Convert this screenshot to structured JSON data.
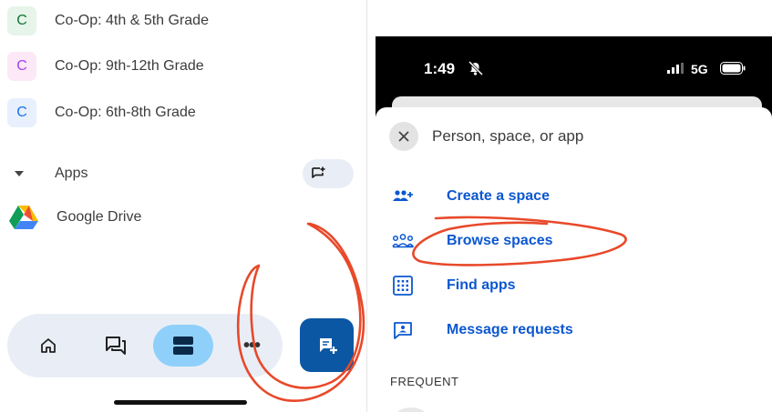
{
  "left_panel": {
    "spaces": [
      {
        "initial": "C",
        "label": "Co-Op: 4th & 5th Grade",
        "bg": "#e6f4ea",
        "fg": "#137333"
      },
      {
        "initial": "C",
        "label": "Co-Op: 9th-12th Grade",
        "bg": "#fce8f6",
        "fg": "#a142f4"
      },
      {
        "initial": "C",
        "label": "Co-Op: 6th-8th Grade",
        "bg": "#e8f0fe",
        "fg": "#1a73e8"
      }
    ],
    "apps_section": {
      "label": "Apps"
    },
    "apps": [
      {
        "label": "Google Drive",
        "icon": "google-drive-icon"
      }
    ],
    "bottom_nav": {
      "items": [
        "home-icon",
        "chat-icon",
        "spaces-icon",
        "more-icon"
      ],
      "more_label": "•••",
      "active": "spaces-icon",
      "active_color": "#8fd0fb"
    },
    "fab": {
      "icon": "new-chat-icon",
      "color": "#0b57a3"
    }
  },
  "phone": {
    "status_bar": {
      "time": "1:49",
      "network": "5G",
      "icons": [
        "bell-off-icon",
        "signal-icon",
        "battery-icon"
      ]
    },
    "sheet": {
      "search_placeholder": "Person, space, or app",
      "menu": [
        {
          "label": "Create a space",
          "icon": "create-space-icon"
        },
        {
          "label": "Browse spaces",
          "icon": "browse-spaces-icon"
        },
        {
          "label": "Find apps",
          "icon": "find-apps-icon"
        },
        {
          "label": "Message requests",
          "icon": "message-requests-icon"
        }
      ],
      "section_label": "FREQUENT",
      "accent": "#0b57d0"
    }
  },
  "annotations": {
    "color": "#e8492a"
  }
}
